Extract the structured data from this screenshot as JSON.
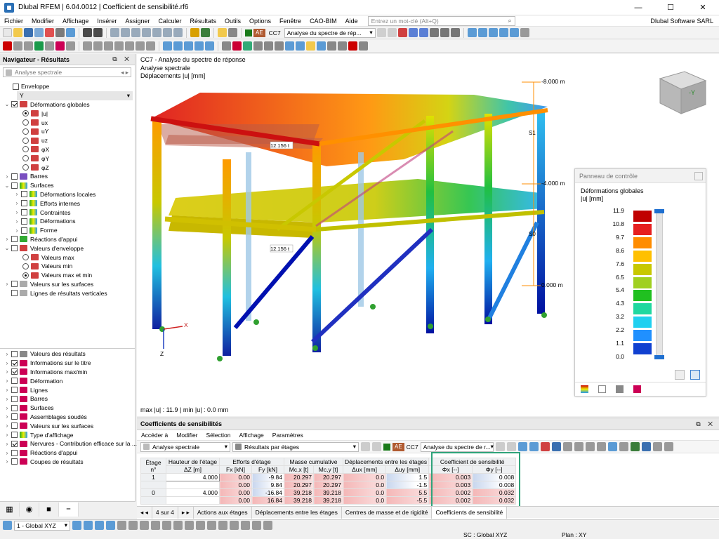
{
  "window": {
    "title": "Dlubal RFEM | 6.04.0012 | Coefficient de sensibilité.rf6",
    "min": "—",
    "max": "☐",
    "close": "✕"
  },
  "menu": {
    "items": [
      "Fichier",
      "Modifier",
      "Affichage",
      "Insérer",
      "Assigner",
      "Calculer",
      "Résultats",
      "Outils",
      "Options",
      "Fenêtre",
      "CAO-BIM",
      "Aide"
    ],
    "search_placeholder": "Entrez un mot-clé (Alt+Q)",
    "company": "Dlubal Software SARL"
  },
  "toolbar1": {
    "load_badge": "AE",
    "load_case": "CC7",
    "analysis": "Analyse du spectre de rép..."
  },
  "navigator": {
    "title": "Navigateur - Résultats",
    "analysis_combo": "Analyse spectrale",
    "top_items": [
      "Enveloppe",
      "Y",
      "Déformations globales",
      "|u|",
      "ux",
      "uY",
      "uz",
      "φX",
      "φY",
      "φZ",
      "Barres",
      "Surfaces",
      "Déformations locales",
      "Efforts internes",
      "Contraintes",
      "Déformations",
      "Forme",
      "Réactions d'appui",
      "Valeurs d'enveloppe",
      "Valeurs max",
      "Valeurs min",
      "Valeurs max et min",
      "Valeurs sur les surfaces",
      "Lignes de résultats verticales"
    ],
    "bottom_items": [
      "Valeurs des résultats",
      "Informations sur le titre",
      "Informations max/min",
      "Déformation",
      "Lignes",
      "Barres",
      "Surfaces",
      "Assemblages soudés",
      "Valeurs sur les surfaces",
      "Type d'affichage",
      "Nervures - Contribution efficace sur la ...",
      "Réactions d'appui",
      "Coupes de résultats"
    ]
  },
  "viewport": {
    "info_lines": [
      "CC7 - Analyse du spectre de réponse",
      "Analyse spectrale",
      "Déplacements |u| [mm]"
    ],
    "level_labels": [
      "-8.000 m",
      "-4.000 m",
      "0.000 m"
    ],
    "story_labels": [
      "S1",
      "S0"
    ],
    "mass_labels": [
      "12.156 t",
      "12.156 t"
    ],
    "axis_x": "X",
    "axis_z": "Z",
    "cube_y": "-Y",
    "maxmin": "max |u| : 11.9 | min |u| : 0.0 mm"
  },
  "control_panel": {
    "title": "Panneau de contrôle",
    "subtitle": "Déformations globales",
    "unit": "|u| [mm]",
    "legend_values": [
      "11.9",
      "10.8",
      "9.7",
      "8.6",
      "7.6",
      "6.5",
      "5.4",
      "4.3",
      "3.2",
      "2.2",
      "1.1",
      "0.0"
    ],
    "legend_colors": [
      "#c00000",
      "#e62020",
      "#ff8c00",
      "#ffc000",
      "#c8c800",
      "#a0d020",
      "#20c020",
      "#20d8a0",
      "#20d0f0",
      "#2090ff",
      "#1040d0",
      "#000090"
    ]
  },
  "results_panel": {
    "title": "Coefficients de sensibilités",
    "menu": [
      "Accéder à",
      "Modifier",
      "Sélection",
      "Affichage",
      "Paramètres"
    ],
    "analysis_combo": "Analyse spectrale",
    "results_combo": "Résultats par étages",
    "load_badge": "AE",
    "load_case": "CC7",
    "analysis": "Analyse du spectre de r...",
    "headers": {
      "etage": "Étage",
      "etage_n": "n°",
      "hauteur": "Hauteur de l'étage",
      "hauteur_sub": "ΔZ [m]",
      "efforts": "Efforts d'étage",
      "fx": "Fx [kN]",
      "fy": "Fy [kN]",
      "masse": "Masse cumulative",
      "mcx": "Mc,x [t]",
      "mcy": "Mc,y [t]",
      "depl": "Déplacements entre les étages",
      "dux": "Δux [mm]",
      "duy": "Δuy [mm]",
      "coef": "Coefficient de sensibilité",
      "phix": "Φx [--]",
      "phiy": "Φy [--]"
    },
    "rows": [
      {
        "etage": "1",
        "hauteur": "4.000",
        "fx": "0.00",
        "fy": "-9.84",
        "mcx": "20.297",
        "mcy": "20.297",
        "dux": "0.0",
        "duy": "1.5",
        "phix": "0.003",
        "phiy": "0.008"
      },
      {
        "etage": "",
        "hauteur": "",
        "fx": "0.00",
        "fy": "9.84",
        "mcx": "20.297",
        "mcy": "20.297",
        "dux": "0.0",
        "duy": "-1.5",
        "phix": "0.003",
        "phiy": "0.008"
      },
      {
        "etage": "0",
        "hauteur": "4.000",
        "fx": "0.00",
        "fy": "-16.84",
        "mcx": "39.218",
        "mcy": "39.218",
        "dux": "0.0",
        "duy": "5.5",
        "phix": "0.002",
        "phiy": "0.032"
      },
      {
        "etage": "",
        "hauteur": "",
        "fx": "0.00",
        "fy": "16.84",
        "mcx": "39.218",
        "mcy": "39.218",
        "dux": "0.0",
        "duy": "-5.5",
        "phix": "0.002",
        "phiy": "0.032"
      }
    ],
    "pager": "4 sur 4",
    "tabs": [
      "Actions aux étages",
      "Déplacements entre les étages",
      "Centres de masse et de rigidité",
      "Coefficients de sensibilité"
    ]
  },
  "statusbar": {
    "cs_combo": "1 - Global XYZ",
    "sc": "SC : Global XYZ",
    "plan": "Plan : XY"
  }
}
